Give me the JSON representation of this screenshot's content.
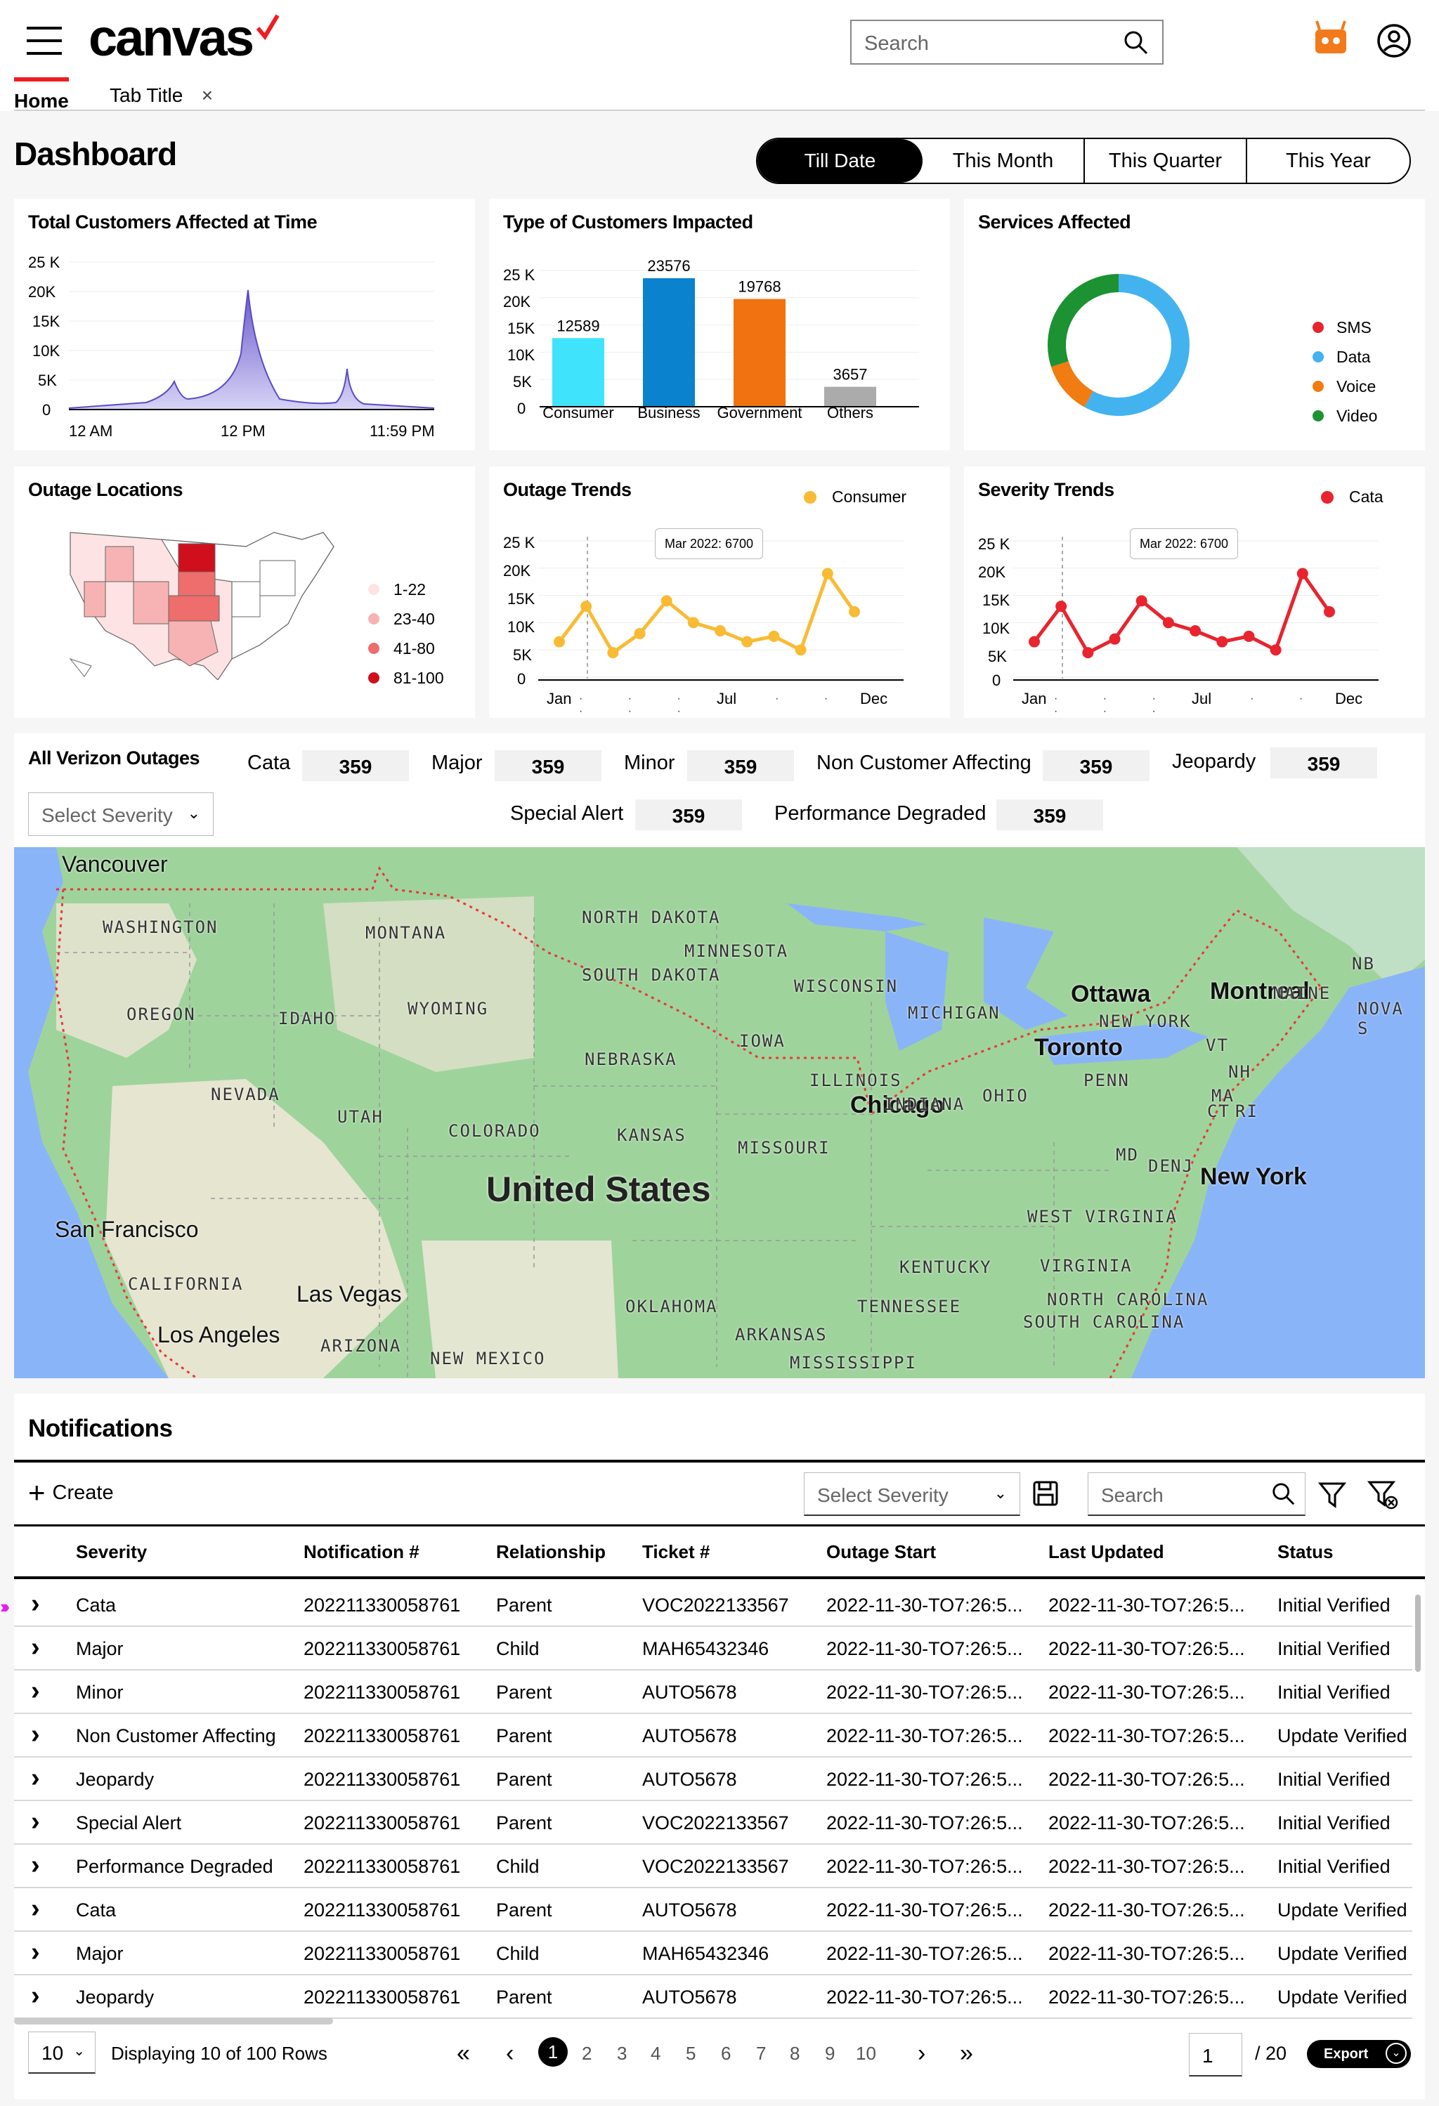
{
  "header": {
    "logo": "canvas",
    "search_placeholder": "Search",
    "tabs": [
      {
        "label": "Home"
      },
      {
        "label": "Tab Title"
      }
    ],
    "tab_close": "×"
  },
  "dashboard": {
    "title": "Dashboard",
    "periods": [
      "Till Date",
      "This Month",
      "This Quarter",
      "This Year"
    ]
  },
  "cards": {
    "total_customers": {
      "title": "Total Customers Affected at Time",
      "y_ticks": [
        "25 K",
        "20K",
        "15K",
        "10K",
        "5K",
        "0"
      ],
      "x_ticks": [
        "12 AM",
        "12 PM",
        "11:59 PM"
      ]
    },
    "type_customers": {
      "title": "Type of Customers Impacted",
      "y_ticks": [
        "25 K",
        "20K",
        "15K",
        "10K",
        "5K",
        "0"
      ]
    },
    "services": {
      "title": "Services Affected",
      "legend": [
        {
          "label": "SMS",
          "color": "#e8242e"
        },
        {
          "label": "Data",
          "color": "#43b3ef"
        },
        {
          "label": "Voice",
          "color": "#f07c12"
        },
        {
          "label": "Video",
          "color": "#1c9232"
        }
      ]
    },
    "outage_locations": {
      "title": "Outage Locations",
      "legend": [
        {
          "label": "1-22",
          "color": "#fde3e3"
        },
        {
          "label": "23-40",
          "color": "#f7b3b3"
        },
        {
          "label": "41-80",
          "color": "#ee6d6d"
        },
        {
          "label": "81-100",
          "color": "#d00f1d"
        }
      ]
    },
    "outage_trends": {
      "title": "Outage Trends",
      "legend": "Consumer",
      "tooltip": "Mar 2022: 6700",
      "y_ticks": [
        "25 K",
        "20K",
        "15K",
        "10K",
        "5K",
        "0"
      ],
      "x_ticks": [
        "Jan",
        "Jul",
        "Dec"
      ]
    },
    "severity_trends": {
      "title": "Severity Trends",
      "legend": "Cata",
      "tooltip": "Mar 2022: 6700",
      "y_ticks": [
        "25 K",
        "20K",
        "15K",
        "10K",
        "5K",
        "0"
      ],
      "x_ticks": [
        "Jan",
        "Jul",
        "Dec"
      ]
    }
  },
  "chart_data": [
    {
      "type": "area",
      "title": "Total Customers Affected at Time",
      "x": [
        "12 AM",
        "12 PM",
        "11:59 PM"
      ],
      "ylim": [
        0,
        25000
      ],
      "peaks": [
        {
          "x": "morning",
          "y": 5500
        },
        {
          "x": "12 PM",
          "y": 20500
        },
        {
          "x": "evening",
          "y": 7000
        }
      ]
    },
    {
      "type": "bar",
      "title": "Type of Customers Impacted",
      "categories": [
        "Consumer",
        "Business",
        "Government",
        "Others"
      ],
      "values": [
        12589,
        23576,
        19768,
        3657
      ],
      "colors": [
        "#3fe3fb",
        "#0a82cd",
        "#f07210",
        "#ababab"
      ],
      "ylim": [
        0,
        25000
      ]
    },
    {
      "type": "pie",
      "title": "Services Affected",
      "categories": [
        "SMS",
        "Data",
        "Voice",
        "Video"
      ],
      "values": [
        0,
        58,
        12,
        30
      ]
    },
    {
      "type": "line",
      "title": "Outage Trends",
      "series": [
        {
          "name": "Consumer",
          "color": "#f9bb34",
          "values": [
            6500,
            13000,
            4500,
            8000,
            14000,
            10000,
            8500,
            6500,
            7500,
            5000,
            19000,
            12000
          ]
        }
      ],
      "ylim": [
        0,
        25000
      ]
    },
    {
      "type": "line",
      "title": "Severity Trends",
      "series": [
        {
          "name": "Cata",
          "color": "#e8242e",
          "values": [
            6500,
            13000,
            4500,
            7000,
            14000,
            10000,
            8500,
            6500,
            7500,
            5000,
            19000,
            12000
          ]
        }
      ],
      "ylim": [
        0,
        25000
      ]
    }
  ],
  "outages": {
    "title": "All Verizon Outages",
    "severity_placeholder": "Select Severity",
    "counts": [
      {
        "label": "Cata",
        "value": "359"
      },
      {
        "label": "Major",
        "value": "359"
      },
      {
        "label": "Minor",
        "value": "359"
      },
      {
        "label": "Non Customer Affecting",
        "value": "359"
      },
      {
        "label": "Jeopardy",
        "value": "359"
      },
      {
        "label": "Special Alert",
        "value": "359"
      },
      {
        "label": "Performance Degraded",
        "value": "359"
      }
    ]
  },
  "map": {
    "country": "United States",
    "cities": [
      "Vancouver",
      "Ottawa",
      "Montreal",
      "Toronto",
      "Chicago",
      "New York",
      "San Francisco",
      "Las Vegas",
      "Los Angeles"
    ],
    "states": [
      "WASHINGTON",
      "MONTANA",
      "NORTH DAKOTA",
      "MINNESOTA",
      "OREGON",
      "IDAHO",
      "WYOMING",
      "SOUTH DAKOTA",
      "WISCONSIN",
      "MICHIGAN",
      "IOWA",
      "NEBRASKA",
      "ILLINOIS",
      "NEVADA",
      "UTAH",
      "COLORADO",
      "KANSAS",
      "MISSOURI",
      "INDIANA",
      "OHIO",
      "PENN",
      "NEW YORK",
      "CALIFORNIA",
      "ARIZONA",
      "NEW MEXICO",
      "OKLAHOMA",
      "ARKANSAS",
      "MISSISSIPPI",
      "TENNESSEE",
      "KENTUCKY",
      "WEST VIRGINIA",
      "VIRGINIA",
      "NORTH CAROLINA",
      "SOUTH CAROLINA",
      "MAINE",
      "VT",
      "NH",
      "MA",
      "CT",
      "RI",
      "MD",
      "DE",
      "NJ",
      "NB",
      "NOVA S"
    ]
  },
  "notifications": {
    "title": "Notifications",
    "create_label": "Create",
    "severity_placeholder": "Select Severity",
    "search_placeholder": "Search",
    "columns": [
      "Severity",
      "Notification #",
      "Relationship",
      "Ticket #",
      "Outage Start",
      "Last Updated",
      "Status"
    ],
    "rows": [
      [
        "Cata",
        "202211330058761",
        "Parent",
        "VOC2022133567",
        "2022-11-30-TO7:26:5...",
        "2022-11-30-TO7:26:5...",
        "Initial Verified"
      ],
      [
        "Major",
        "202211330058761",
        "Child",
        "MAH65432346",
        "2022-11-30-TO7:26:5...",
        "2022-11-30-TO7:26:5...",
        "Initial Verified"
      ],
      [
        "Minor",
        "202211330058761",
        "Parent",
        "AUTO5678",
        "2022-11-30-TO7:26:5...",
        "2022-11-30-TO7:26:5...",
        "Initial Verified"
      ],
      [
        "Non Customer Affecting",
        "202211330058761",
        "Parent",
        "AUTO5678",
        "2022-11-30-TO7:26:5...",
        "2022-11-30-TO7:26:5...",
        "Update Verified"
      ],
      [
        "Jeopardy",
        "202211330058761",
        "Parent",
        "AUTO5678",
        "2022-11-30-TO7:26:5...",
        "2022-11-30-TO7:26:5...",
        "Initial Verified"
      ],
      [
        "Special Alert",
        "202211330058761",
        "Parent",
        "VOC2022133567",
        "2022-11-30-TO7:26:5...",
        "2022-11-30-TO7:26:5...",
        "Initial Verified"
      ],
      [
        "Performance Degraded",
        "202211330058761",
        "Child",
        "VOC2022133567",
        "2022-11-30-TO7:26:5...",
        "2022-11-30-TO7:26:5...",
        "Initial Verified"
      ],
      [
        "Cata",
        "202211330058761",
        "Parent",
        "AUTO5678",
        "2022-11-30-TO7:26:5...",
        "2022-11-30-TO7:26:5...",
        "Update Verified"
      ],
      [
        "Major",
        "202211330058761",
        "Child",
        "MAH65432346",
        "2022-11-30-TO7:26:5...",
        "2022-11-30-TO7:26:5...",
        "Update Verified"
      ],
      [
        "Jeopardy",
        "202211330058761",
        "Parent",
        "AUTO5678",
        "2022-11-30-TO7:26:5...",
        "2022-11-30-TO7:26:5...",
        "Update Verified"
      ]
    ],
    "pagination": {
      "rows_per_page": "10",
      "displaying": "Displaying 10 of 100 Rows",
      "pages": [
        "1",
        "2",
        "3",
        "4",
        "5",
        "6",
        "7",
        "8",
        "9",
        "10"
      ],
      "current_page": "1",
      "total_pages": "/ 20",
      "export_label": "Export"
    }
  }
}
